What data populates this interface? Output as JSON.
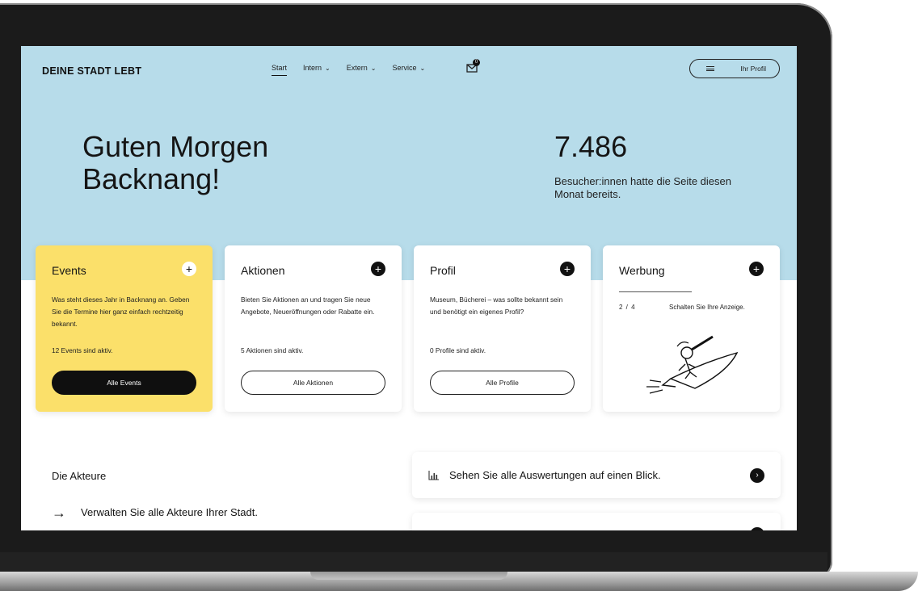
{
  "nav": {
    "logo": "DEINE STADT LEBT",
    "items": [
      {
        "label": "Start",
        "active": true,
        "chevron": false
      },
      {
        "label": "Intern",
        "active": false,
        "chevron": true
      },
      {
        "label": "Extern",
        "active": false,
        "chevron": true
      },
      {
        "label": "Service",
        "active": false,
        "chevron": true
      }
    ],
    "chevron_glyph": "⌄",
    "mail_badge": "0",
    "profile_label": "Ihr Profil"
  },
  "hero": {
    "greeting_line1": "Guten Morgen",
    "greeting_line2": "Backnang!",
    "stat_value": "7.486",
    "stat_label": "Besucher:innen hatte die Seite diesen Monat bereits."
  },
  "cards": {
    "events": {
      "title": "Events",
      "description": "Was steht dieses Jahr in Backnang an. Geben Sie die Termine hier ganz einfach rechtzeitig bekannt.",
      "count": "12 Events sind aktiv.",
      "button": "Alle Events"
    },
    "aktionen": {
      "title": "Aktionen",
      "description": "Bieten Sie Aktionen an und tragen Sie neue Angebote, Neueröffnungen oder Rabatte ein.",
      "count": "5 Aktionen sind aktiv.",
      "button": "Alle Aktionen"
    },
    "profil": {
      "title": "Profil",
      "description": "Museum, Bücherei – was sollte bekannt sein und benötigt ein eigenes Profil?",
      "count": "0 Profile sind aktiv.",
      "button": "Alle Profile"
    },
    "werbung": {
      "title": "Werbung",
      "pager": "2 / 4",
      "text": "Schalten Sie Ihre Anzeige."
    },
    "plus_glyph": "+"
  },
  "actors": {
    "title": "Die Akteure",
    "arrow_glyph": "→",
    "link": "Verwalten Sie alle Akteure Ihrer Stadt."
  },
  "insights": {
    "text": "Sehen Sie alle Auswertungen auf einen Blick.",
    "next_glyph": "›"
  },
  "colors": {
    "hero_bg": "#b7dcea",
    "events_card": "#fbe06a",
    "dark": "#0f0f0f"
  }
}
